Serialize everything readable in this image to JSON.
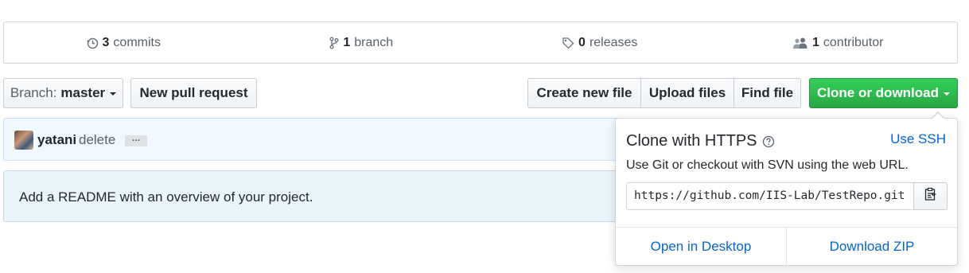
{
  "stats": {
    "commits": {
      "count": "3",
      "label": "commits",
      "icon": "history-icon"
    },
    "branches": {
      "count": "1",
      "label": "branch",
      "icon": "branch-icon"
    },
    "releases": {
      "count": "0",
      "label": "releases",
      "icon": "tag-icon"
    },
    "contributors": {
      "count": "1",
      "label": "contributor",
      "icon": "people-icon"
    }
  },
  "toolbar": {
    "branch_label": "Branch:",
    "branch_value": "master",
    "new_pr": "New pull request",
    "create_file": "Create new file",
    "upload_files": "Upload files",
    "find_file": "Find file",
    "clone_download": "Clone or download"
  },
  "commit": {
    "author": "yatani",
    "message": "delete",
    "more": "…"
  },
  "readme": {
    "text": "Add a README with an overview of your project."
  },
  "clone_dropdown": {
    "title": "Clone with HTTPS",
    "use_ssh": "Use SSH",
    "description": "Use Git or checkout with SVN using the web URL.",
    "url": "https://github.com/IIS-Lab/TestRepo.git",
    "open_desktop": "Open in Desktop",
    "download_zip": "Download ZIP"
  },
  "colors": {
    "accent_green": "#28a745",
    "link_blue": "#0366d6",
    "commit_bg": "#f1f8ff",
    "readme_bg": "#eaf4fb"
  }
}
